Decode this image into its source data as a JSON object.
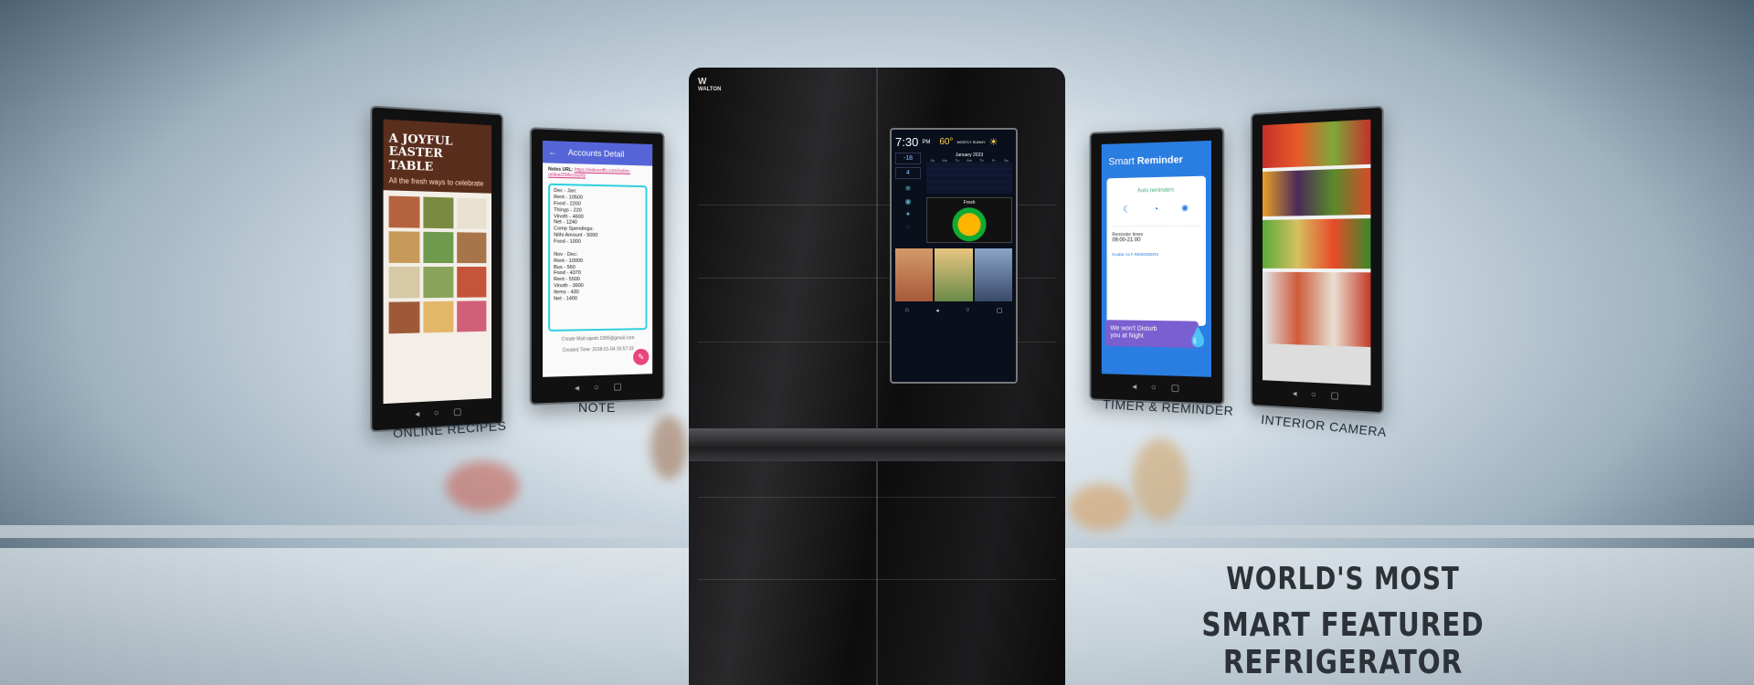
{
  "headline": {
    "line1": "WORLD'S MOST",
    "line2": "SMART FEATURED REFRIGERATOR"
  },
  "brand": "WALTON",
  "features": [
    {
      "label": "ONLINE RECIPES"
    },
    {
      "label": "NOTE"
    },
    {
      "label": "TIMER & REMINDER"
    },
    {
      "label": "INTERIOR CAMERA"
    }
  ],
  "recipes_screen": {
    "title": "A JOYFUL EASTER TABLE",
    "subtitle": "All the fresh ways to celebrate"
  },
  "note_screen": {
    "header": "Accounts Detail",
    "notes_url_label": "Notes URL:",
    "notes_url": "https://onlineoffs.com/notes-online/29Accounts",
    "lines": [
      "Dec - Jan:",
      "Rent - 10500",
      "Food - 2200",
      "Things - 220",
      "Vinoth - 4600",
      "Net - 1240",
      "Comp Spendings:",
      "Nithi Amount - 5000",
      "Food - 1000",
      "",
      "Nov - Dec:",
      "Rent - 10000",
      "Bus - 560",
      "Food - 4370",
      "Rent - 5500",
      "Vinoth - 3600",
      "Items - 430",
      "Net - 1400"
    ],
    "creator": "Create Mail:rajesh.1995@gmail.com",
    "created_time": "Created Time: 2018-01-04 16:57:33"
  },
  "reminder_screen": {
    "title_prefix": "Smart",
    "title_bold": "Reminder",
    "auto_reminders": "Auto reminders",
    "reminder_times_label": "Reminder times",
    "reminder_times_value": "09:00-21:00",
    "set_reminders": "Enable 24 h REMINDERS",
    "night_line1": "We won't Disturb",
    "night_line2": "you at Night"
  },
  "fridge_screen": {
    "time": "7:30",
    "ampm": "PM",
    "temp": "60°",
    "weather": "MOSTLY SUNNY",
    "month": "January 2023",
    "weekdays": [
      "Su",
      "Mo",
      "Tu",
      "We",
      "Th",
      "Fr",
      "Sa"
    ],
    "temp_readout_1": "-18",
    "temp_readout_2": "4",
    "fresh_label": "Fresh"
  },
  "colors": {
    "note_header": "#5565d8",
    "note_border": "#2bd0e0",
    "reminder_bg": "#2a7de1",
    "fab_pink": "#e8457c",
    "night_banner": "#7a5fd0"
  }
}
